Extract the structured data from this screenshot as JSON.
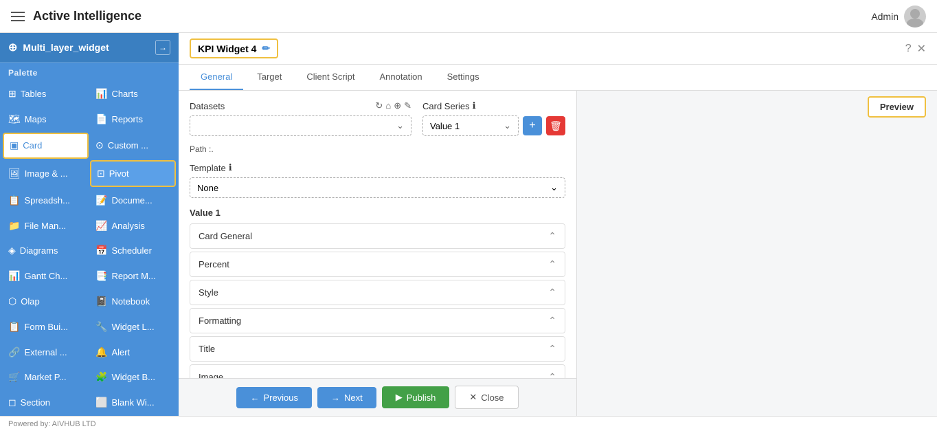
{
  "topbar": {
    "title": "Active Intelligence",
    "admin_label": "Admin"
  },
  "sidebar": {
    "widget_name": "Multi_layer_widget",
    "palette_label": "Palette",
    "items": [
      {
        "id": "tables",
        "label": "Tables",
        "icon": "⊞",
        "col": 1
      },
      {
        "id": "charts",
        "label": "Charts",
        "icon": "📊",
        "col": 2
      },
      {
        "id": "maps",
        "label": "Maps",
        "icon": "🗺",
        "col": 1
      },
      {
        "id": "reports",
        "label": "Reports",
        "icon": "📄",
        "col": 2
      },
      {
        "id": "card",
        "label": "Card",
        "icon": "▣",
        "col": 1,
        "active": true
      },
      {
        "id": "custom",
        "label": "Custom ...",
        "icon": "⊙",
        "col": 2
      },
      {
        "id": "image",
        "label": "Image & ...",
        "icon": "🖼",
        "col": 1
      },
      {
        "id": "pivot",
        "label": "Pivot",
        "icon": "⊡",
        "col": 2,
        "highlighted": true
      },
      {
        "id": "spreadsheet",
        "label": "Spreadsh...",
        "icon": "📋",
        "col": 1
      },
      {
        "id": "document",
        "label": "Docume...",
        "icon": "📝",
        "col": 2
      },
      {
        "id": "fileman",
        "label": "File Man...",
        "icon": "📁",
        "col": 1
      },
      {
        "id": "analysis",
        "label": "Analysis",
        "icon": "📈",
        "col": 2
      },
      {
        "id": "diagrams",
        "label": "Diagrams",
        "icon": "◈",
        "col": 1
      },
      {
        "id": "scheduler",
        "label": "Scheduler",
        "icon": "📅",
        "col": 2
      },
      {
        "id": "gantt",
        "label": "Gantt Ch...",
        "icon": "📊",
        "col": 1
      },
      {
        "id": "reportm",
        "label": "Report M...",
        "icon": "📑",
        "col": 2
      },
      {
        "id": "olap",
        "label": "Olap",
        "icon": "⬡",
        "col": 1
      },
      {
        "id": "notebook",
        "label": "Notebook",
        "icon": "📓",
        "col": 2
      },
      {
        "id": "formbui",
        "label": "Form Bui...",
        "icon": "📋",
        "col": 1
      },
      {
        "id": "widgetl",
        "label": "Widget L...",
        "icon": "🔧",
        "col": 2
      },
      {
        "id": "external",
        "label": "External ...",
        "icon": "🔗",
        "col": 1
      },
      {
        "id": "alert",
        "label": "Alert",
        "icon": "🔔",
        "col": 2
      },
      {
        "id": "marketp",
        "label": "Market P...",
        "icon": "🛒",
        "col": 1
      },
      {
        "id": "widgetb",
        "label": "Widget B...",
        "icon": "🧩",
        "col": 2
      },
      {
        "id": "section",
        "label": "Section",
        "icon": "◻",
        "col": 1
      },
      {
        "id": "blankwi",
        "label": "Blank Wi...",
        "icon": "⬜",
        "col": 2
      }
    ]
  },
  "widget": {
    "title": "KPI Widget 4",
    "tabs": [
      {
        "id": "general",
        "label": "General",
        "active": true
      },
      {
        "id": "target",
        "label": "Target"
      },
      {
        "id": "clientscript",
        "label": "Client Script"
      },
      {
        "id": "annotation",
        "label": "Annotation"
      },
      {
        "id": "settings",
        "label": "Settings"
      }
    ],
    "datasets_label": "Datasets",
    "datasets_value": "",
    "path_label": "Path :.",
    "card_series_label": "Card Series",
    "card_series_info": "ℹ",
    "card_series_value": "Value 1",
    "template_label": "Template",
    "template_info": "ℹ",
    "template_value": "None",
    "value_section_label": "Value 1",
    "accordion_items": [
      {
        "id": "card-general",
        "label": "Card General"
      },
      {
        "id": "percent",
        "label": "Percent"
      },
      {
        "id": "style",
        "label": "Style"
      },
      {
        "id": "formatting",
        "label": "Formatting"
      },
      {
        "id": "title",
        "label": "Title"
      },
      {
        "id": "image",
        "label": "Image"
      }
    ],
    "preview_btn": "Preview",
    "btn_previous": "Previous",
    "btn_next": "Next",
    "btn_publish": "Publish",
    "btn_close": "Close"
  },
  "footer": {
    "text": "Powered by: AIVHUB LTD"
  },
  "icons": {
    "hamburger": "≡",
    "edit": "✏",
    "help": "?",
    "close": "✕",
    "chevron_down": "⌄",
    "chevron_up": "⌃",
    "arrow_left": "←",
    "arrow_right": "→",
    "plus": "+",
    "trash": "🗑",
    "x": "✕",
    "refresh": "↻",
    "home": "⌂",
    "add_circle": "⊕",
    "edit2": "✎"
  }
}
